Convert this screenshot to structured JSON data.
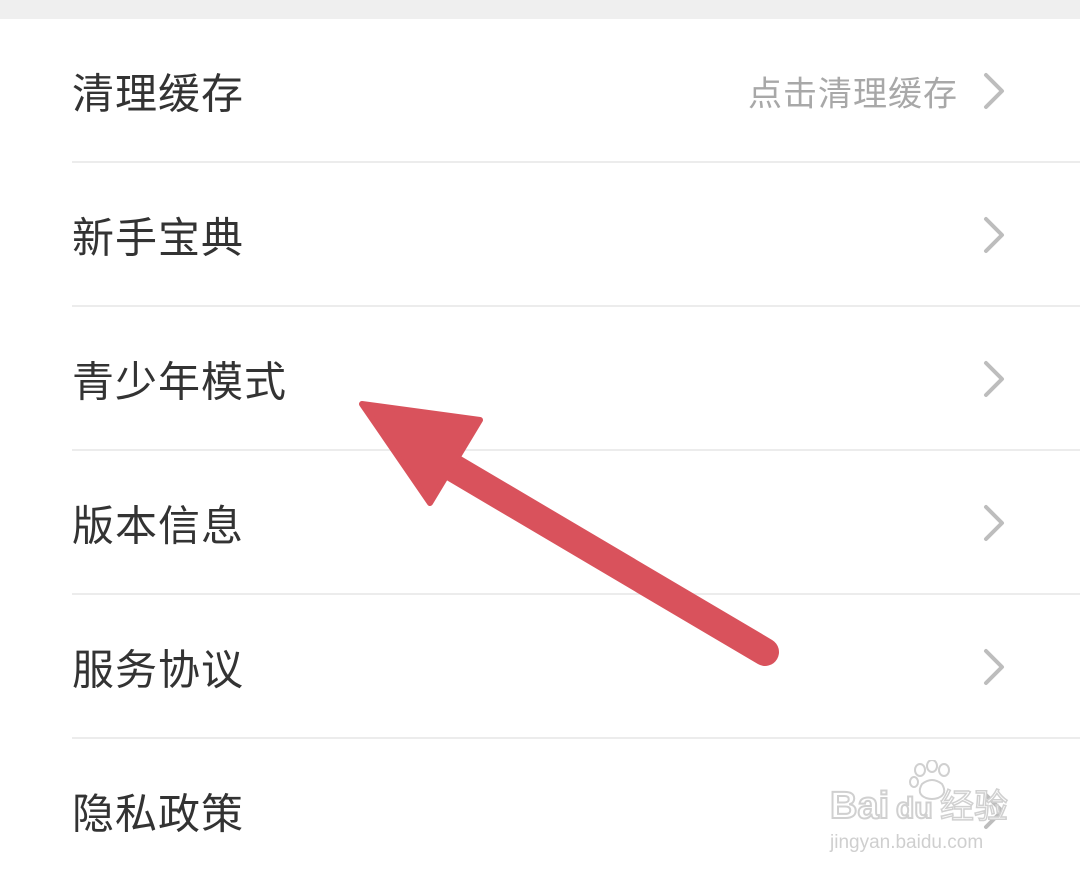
{
  "settings": {
    "items": [
      {
        "label": "清理缓存",
        "value": "点击清理缓存"
      },
      {
        "label": "新手宝典",
        "value": ""
      },
      {
        "label": "青少年模式",
        "value": ""
      },
      {
        "label": "版本信息",
        "value": ""
      },
      {
        "label": "服务协议",
        "value": ""
      },
      {
        "label": "隐私政策",
        "value": ""
      }
    ]
  },
  "icons": {
    "row_chevron": "chevron-right-icon",
    "annotation": "arrow-annotation-icon"
  },
  "colors": {
    "label": "#333333",
    "value": "#a8a8a8",
    "chevron": "#bdbdbd",
    "divider": "#ececec",
    "top_gap": "#efefef",
    "annotation_arrow": "#d9525c"
  },
  "watermark": {
    "brand_latin": "Bai",
    "brand_du": "du",
    "brand_cn": "经验",
    "url": "jingyan.baidu.com"
  }
}
